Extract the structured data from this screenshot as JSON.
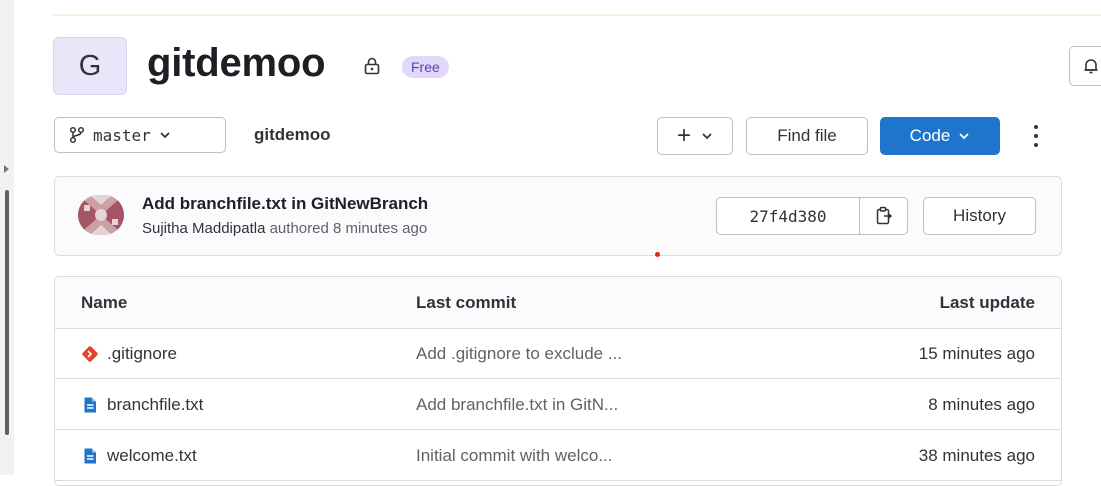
{
  "colors": {
    "accent": "#1f75cb",
    "badge_bg": "#e1d8f9",
    "badge_text": "#5943b6",
    "git_icon": "#e24329",
    "file_icon": "#1f75cb"
  },
  "project": {
    "avatar_letter": "G",
    "name": "gitdemoo",
    "visibility_icon": "lock-icon",
    "tier_badge": "Free"
  },
  "toolbar": {
    "branch": "master",
    "breadcrumb": "gitdemoo",
    "plus_label": "+",
    "find_file_label": "Find file",
    "code_label": "Code"
  },
  "last_commit": {
    "title": "Add branchfile.txt in GitNewBranch",
    "author": "Sujitha Maddipatla",
    "meta_suffix": "authored 8 minutes ago",
    "sha": "27f4d380",
    "history_label": "History"
  },
  "file_table": {
    "headers": {
      "name": "Name",
      "last_commit": "Last commit",
      "last_update": "Last update"
    },
    "rows": [
      {
        "name": ".gitignore",
        "icon": "git-icon",
        "commit": "Add .gitignore to exclude ...",
        "updated": "15 minutes ago"
      },
      {
        "name": "branchfile.txt",
        "icon": "file-icon",
        "commit": "Add branchfile.txt in GitN...",
        "updated": "8 minutes ago"
      },
      {
        "name": "welcome.txt",
        "icon": "file-icon",
        "commit": "Initial commit with welco...",
        "updated": "38 minutes ago"
      }
    ]
  }
}
